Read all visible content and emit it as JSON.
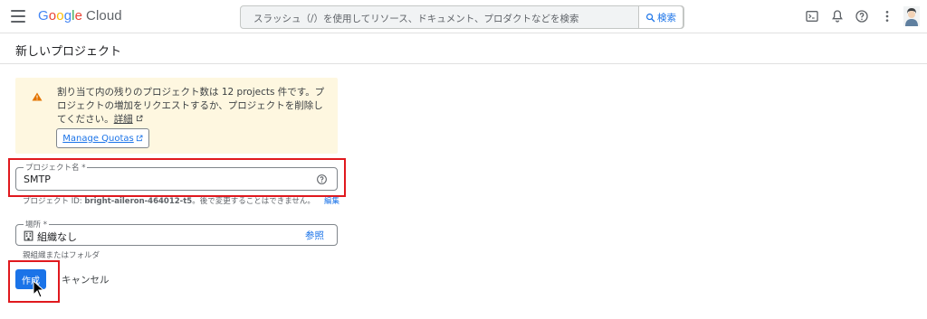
{
  "header": {
    "logo_google": [
      "G",
      "o",
      "o",
      "g",
      "l",
      "e"
    ],
    "logo_cloud": "Cloud",
    "search_placeholder": "スラッシュ（/）を使用してリソース、ドキュメント、プロダクトなどを検索",
    "search_button": "検索",
    "icons": [
      "terminal-icon",
      "bell-icon",
      "help-icon",
      "more-vert-icon",
      "avatar"
    ]
  },
  "page": {
    "title": "新しいプロジェクト"
  },
  "warning": {
    "text": "割り当て内の残りのプロジェクト数は 12 projects 件です。プロジェクトの増加をリクエストするか、プロジェクトを削除してください。",
    "link": "詳細",
    "quota_button": "Manage Quotas"
  },
  "project_name": {
    "label": "プロジェクト名 *",
    "value": "SMTP",
    "hint_prefix": "プロジェクト ID: ",
    "hint_id": "bright-aileron-464012-t5",
    "hint_suffix": "。後で変更することはできません。",
    "edit": "編集"
  },
  "location": {
    "label": "場所 *",
    "value": "組織なし",
    "browse": "参照",
    "hint": "親組織またはフォルダ"
  },
  "actions": {
    "create": "作成",
    "cancel": "キャンセル"
  },
  "colors": {
    "accent": "#1a73e8",
    "warning_bg": "#fef7e0",
    "warning_icon": "#e37400",
    "highlight": "#e0191e"
  }
}
